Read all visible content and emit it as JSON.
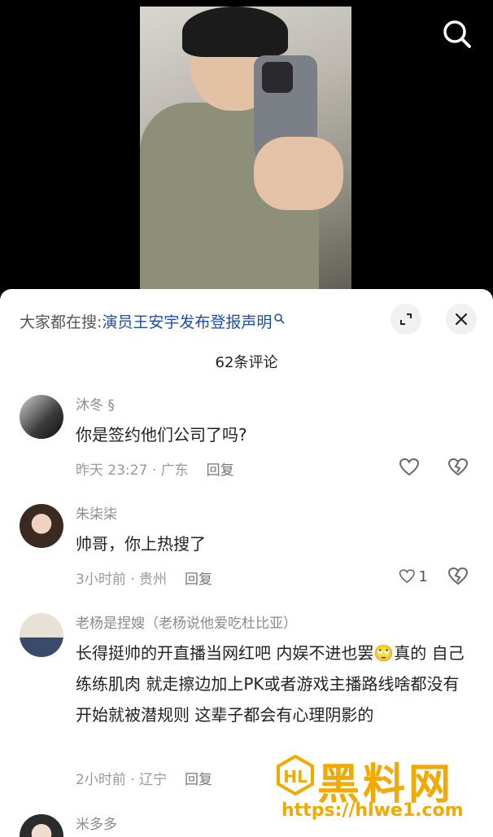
{
  "hot_search": {
    "prefix": "大家都在搜:",
    "query": "演员王安宇发布登报声明"
  },
  "comments_count": "62条评论",
  "comments": [
    {
      "name": "沐冬 §",
      "text": "你是签约他们公司了吗?",
      "meta": "昨天 23:27 · 广东",
      "reply_label": "回复",
      "likes": ""
    },
    {
      "name": "朱柒柒",
      "text": "帅哥，你上热搜了",
      "meta": "3小时前 · 贵州",
      "reply_label": "回复",
      "likes": "1"
    },
    {
      "name": "老杨是捏嫂（老杨说他爱吃杜比亚）",
      "text": "长得挺帅的开直播当网红吧 内娱不进也罢🙄真的 自己练练肌肉 就走擦边加上PK或者游戏主播路线啥都没有开始就被潜规则 这辈子都会有心理阴影的",
      "meta": "2小时前 · 辽宁",
      "reply_label": "回复",
      "likes": ""
    },
    {
      "name": "米多多",
      "text": "",
      "meta": "",
      "reply_label": "",
      "likes": ""
    }
  ],
  "watermark": {
    "logo_text": "HL",
    "title": "黑料网",
    "url": "https://hlwe1.com"
  },
  "icons": {
    "search": "search-icon",
    "expand": "expand-icon",
    "close": "close-icon",
    "like": "heart-icon",
    "dislike": "broken-heart-icon"
  },
  "colors": {
    "link": "#1f4fa5",
    "watermark": "#f2a900"
  }
}
